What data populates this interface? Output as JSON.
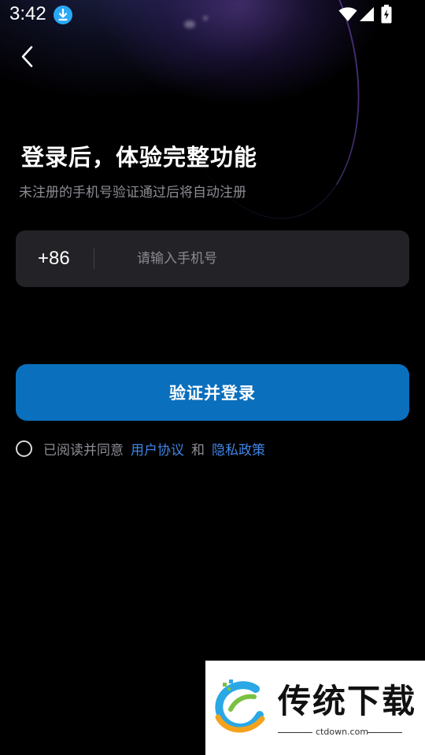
{
  "status_bar": {
    "time": "3:42",
    "icons": [
      "download-icon",
      "wifi-icon",
      "signal-icon",
      "battery-charging-icon"
    ]
  },
  "header": {
    "back_icon": "chevron-left-icon"
  },
  "main": {
    "title": "登录后，体验完整功能",
    "subtitle": "未注册的手机号验证通过后将自动注册",
    "phone": {
      "country_code": "+86",
      "value": "",
      "placeholder": "请输入手机号"
    },
    "login_button_label": "验证并登录",
    "agreement": {
      "checked": false,
      "prefix": "已阅读并同意",
      "user_agreement": "用户协议",
      "and": "和",
      "privacy_policy": "隐私政策"
    }
  },
  "watermark": {
    "name": "传统下载",
    "url": "ctdown.com"
  },
  "colors": {
    "background": "#000000",
    "accent_button": "#0a6fbd",
    "link": "#3f85e6",
    "input_background": "#232327",
    "muted_text": "#8c8c94"
  }
}
